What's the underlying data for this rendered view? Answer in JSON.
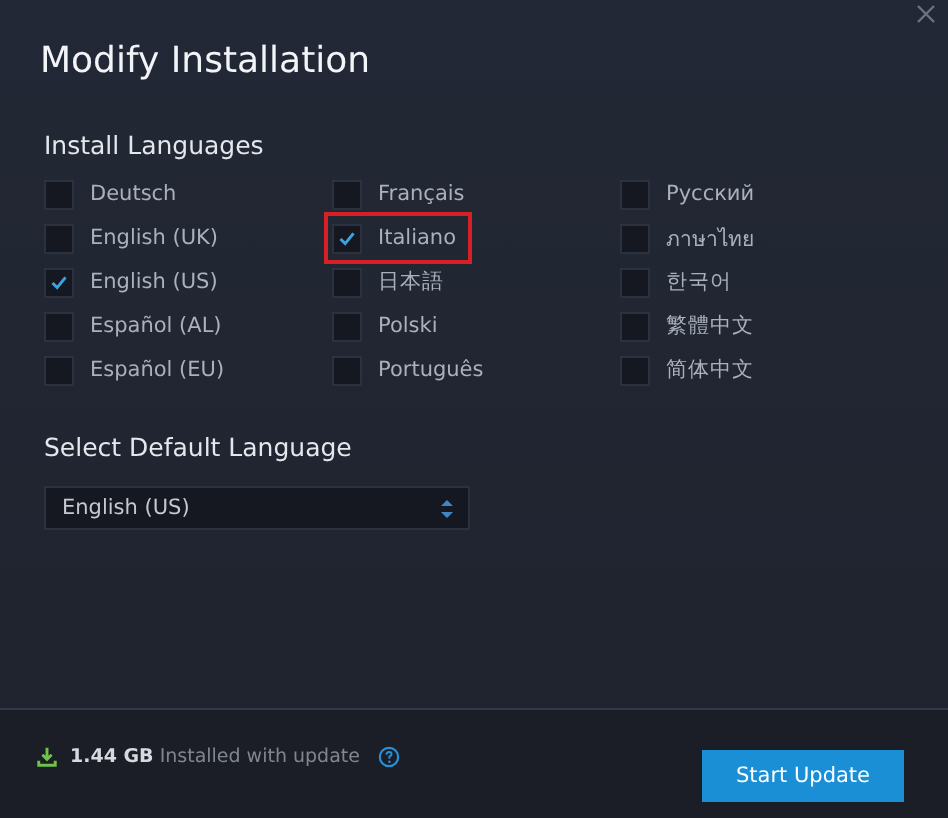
{
  "window": {
    "title": "Modify Installation"
  },
  "install_languages": {
    "heading": "Install Languages",
    "columns": [
      [
        {
          "label": "Deutsch",
          "checked": false,
          "highlighted": false
        },
        {
          "label": "English (UK)",
          "checked": false,
          "highlighted": false
        },
        {
          "label": "English (US)",
          "checked": true,
          "highlighted": false
        },
        {
          "label": "Español (AL)",
          "checked": false,
          "highlighted": false
        },
        {
          "label": "Español (EU)",
          "checked": false,
          "highlighted": false
        }
      ],
      [
        {
          "label": "Français",
          "checked": false,
          "highlighted": false
        },
        {
          "label": "Italiano",
          "checked": true,
          "highlighted": true
        },
        {
          "label": "日本語",
          "checked": false,
          "highlighted": false
        },
        {
          "label": "Polski",
          "checked": false,
          "highlighted": false
        },
        {
          "label": "Português",
          "checked": false,
          "highlighted": false
        }
      ],
      [
        {
          "label": "Русский",
          "checked": false,
          "highlighted": false
        },
        {
          "label": "ภาษาไทย",
          "checked": false,
          "highlighted": false
        },
        {
          "label": "한국어",
          "checked": false,
          "highlighted": false
        },
        {
          "label": "繁體中文",
          "checked": false,
          "highlighted": false
        },
        {
          "label": "简体中文",
          "checked": false,
          "highlighted": false
        }
      ]
    ]
  },
  "default_language": {
    "heading": "Select Default Language",
    "value": "English (US)"
  },
  "footer": {
    "size_text": "**1.44 GB** Installed with update",
    "button": "Start Update"
  }
}
